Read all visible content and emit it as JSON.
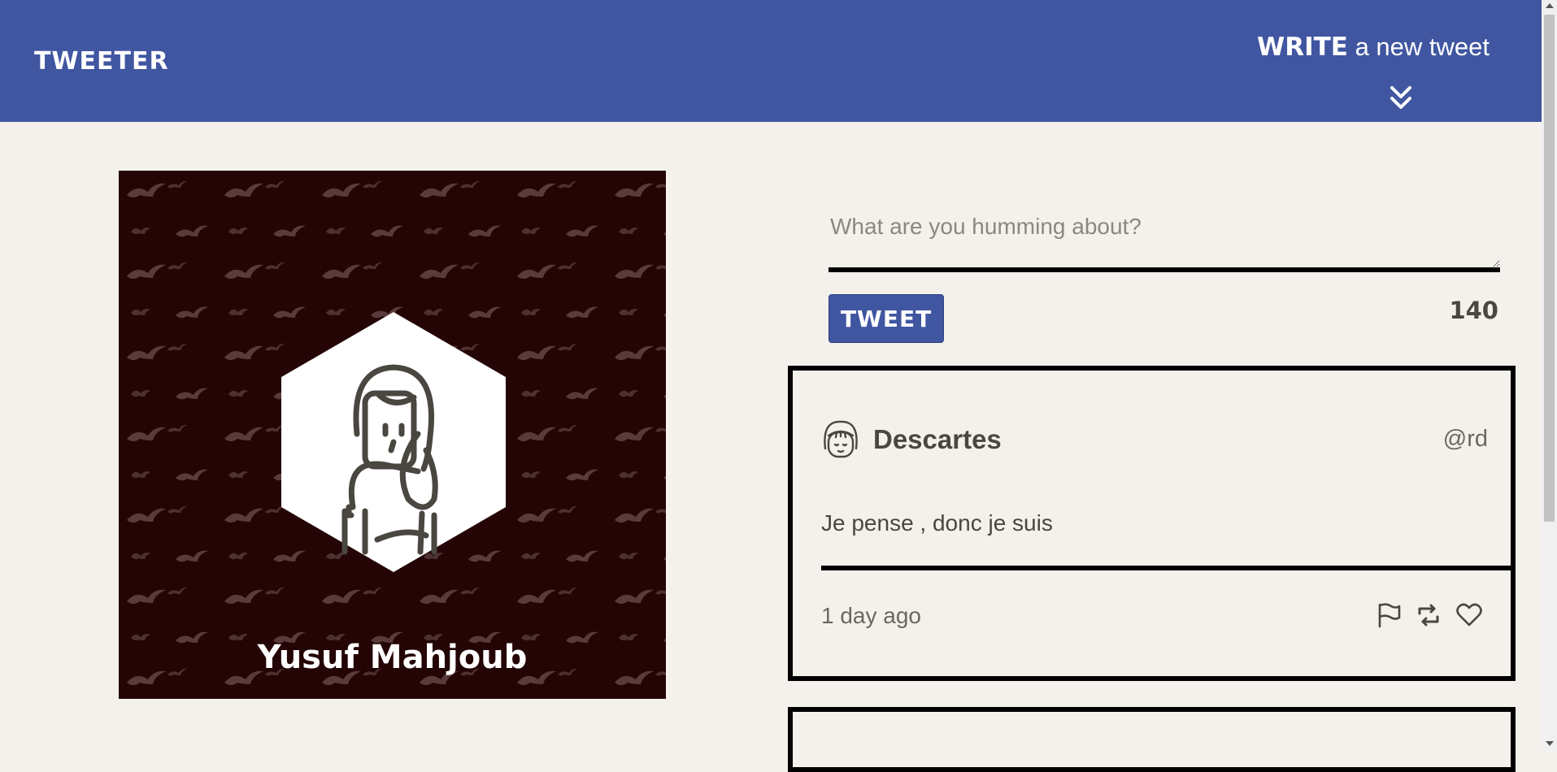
{
  "nav": {
    "brand": "TWEETER",
    "write_strong": "WRITE",
    "write_rest": " a new tweet",
    "toggle_icon": "double-chevron-down-icon"
  },
  "profile": {
    "name": "Yusuf Mahjoub",
    "background_color": "#240404",
    "avatar_icon": "person-hexagon-icon"
  },
  "compose": {
    "placeholder": "What are you humming about?",
    "button_label": "TWEET",
    "counter": "140"
  },
  "tweets": [
    {
      "author": "Descartes",
      "handle": "@rd",
      "content": "Je pense , donc je suis",
      "time": "1 day ago",
      "actions": [
        "flag-icon",
        "retweet-icon",
        "heart-icon"
      ]
    }
  ],
  "colors": {
    "nav": "#4056a1",
    "page_bg": "#f4f1ec",
    "text": "#4a4640"
  }
}
